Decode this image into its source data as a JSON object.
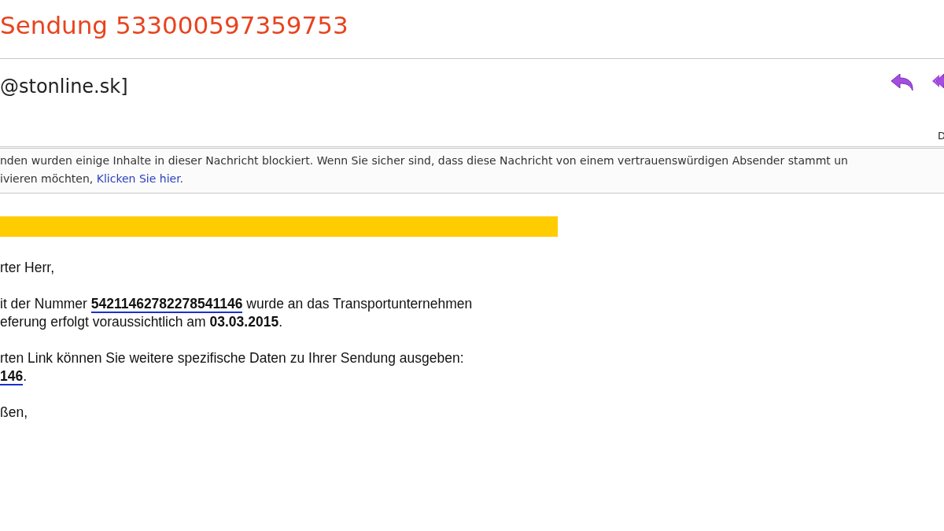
{
  "subject": "Sendung 533000597359753",
  "sender": "@stonline.sk]",
  "date_fragment": "D",
  "info_bar": {
    "lines": [
      {
        "text": "nden wurden einige Inhalte in dieser Nachricht blockiert. Wenn Sie sicher sind, dass diese Nachricht von einem vertrauenswürdigen Absender stammt un"
      },
      {
        "text": "ivieren möchten, ",
        "link": "Klicken Sie hier."
      }
    ]
  },
  "body": [
    {
      "lines": [
        [
          {
            "kind": "text",
            "text": "rter Herr,"
          }
        ]
      ]
    },
    {
      "lines": [
        [
          {
            "kind": "text",
            "text": "it der Nummer "
          },
          {
            "kind": "link",
            "text": "54211462782278541146"
          },
          {
            "kind": "text",
            "text": " wurde an das Transportunternehmen"
          }
        ],
        [
          {
            "kind": "text",
            "text": "eferung erfolgt voraussichtlich am **03.03.2015**."
          }
        ]
      ]
    },
    {
      "lines": [
        [
          {
            "kind": "text",
            "text": "rten Link können Sie weitere spezifische Daten zu Ihrer Sendung ausgeben:"
          }
        ],
        [
          {
            "kind": "link",
            "text": "146"
          },
          {
            "kind": "text",
            "text": "."
          }
        ]
      ]
    },
    {
      "lines": [
        [
          {
            "kind": "text",
            "text": "ßen,"
          }
        ]
      ]
    }
  ]
}
